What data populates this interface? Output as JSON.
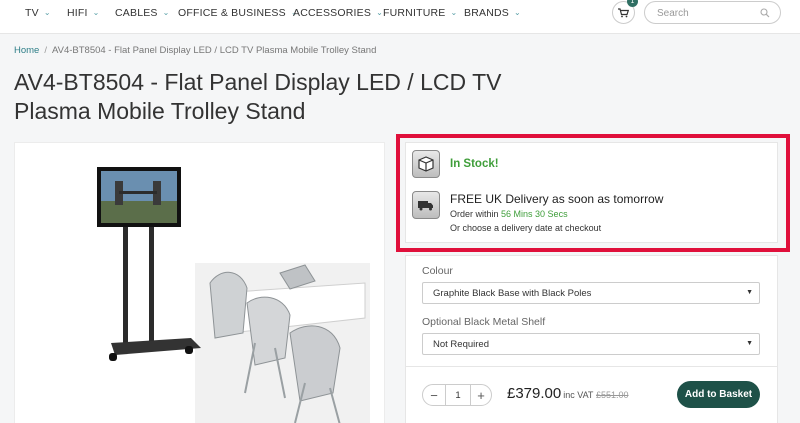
{
  "nav": {
    "items": [
      {
        "label": "TV"
      },
      {
        "label": "HIFI"
      },
      {
        "label": "CABLES"
      },
      {
        "label": "OFFICE & BUSINESS"
      },
      {
        "label": "ACCESSORIES"
      },
      {
        "label": "FURNITURE"
      },
      {
        "label": "BRANDS"
      }
    ],
    "cart_count": "1",
    "search_placeholder": "Search"
  },
  "breadcrumb": {
    "home": "Home",
    "separator": "/",
    "current": "AV4-BT8504 - Flat Panel Display LED / LCD TV Plasma Mobile Trolley Stand"
  },
  "product": {
    "title_line1": "AV4-BT8504 - Flat Panel Display LED / LCD TV",
    "title_line2": "Plasma Mobile Trolley Stand"
  },
  "stock": {
    "status": "In Stock!",
    "delivery_title": "FREE UK Delivery as soon as tomorrow",
    "order_within_prefix": "Order within",
    "countdown": "56 Mins 30 Secs",
    "choose_date": "Or choose a delivery date at checkout"
  },
  "options": {
    "colour_label": "Colour",
    "colour_value": "Graphite Black Base with Black Poles",
    "shelf_label": "Optional Black Metal Shelf",
    "shelf_value": "Not Required"
  },
  "purchase": {
    "quantity": "1",
    "minus": "−",
    "plus": "+",
    "price": "£379.00",
    "vat_label": "inc VAT",
    "old_price": "£551.00",
    "add_to_basket": "Add to Basket"
  },
  "colors": {
    "accent": "#1e5148",
    "link": "#2f7f88",
    "in_stock": "#3f9e3a",
    "highlight_border": "#e0103b"
  }
}
